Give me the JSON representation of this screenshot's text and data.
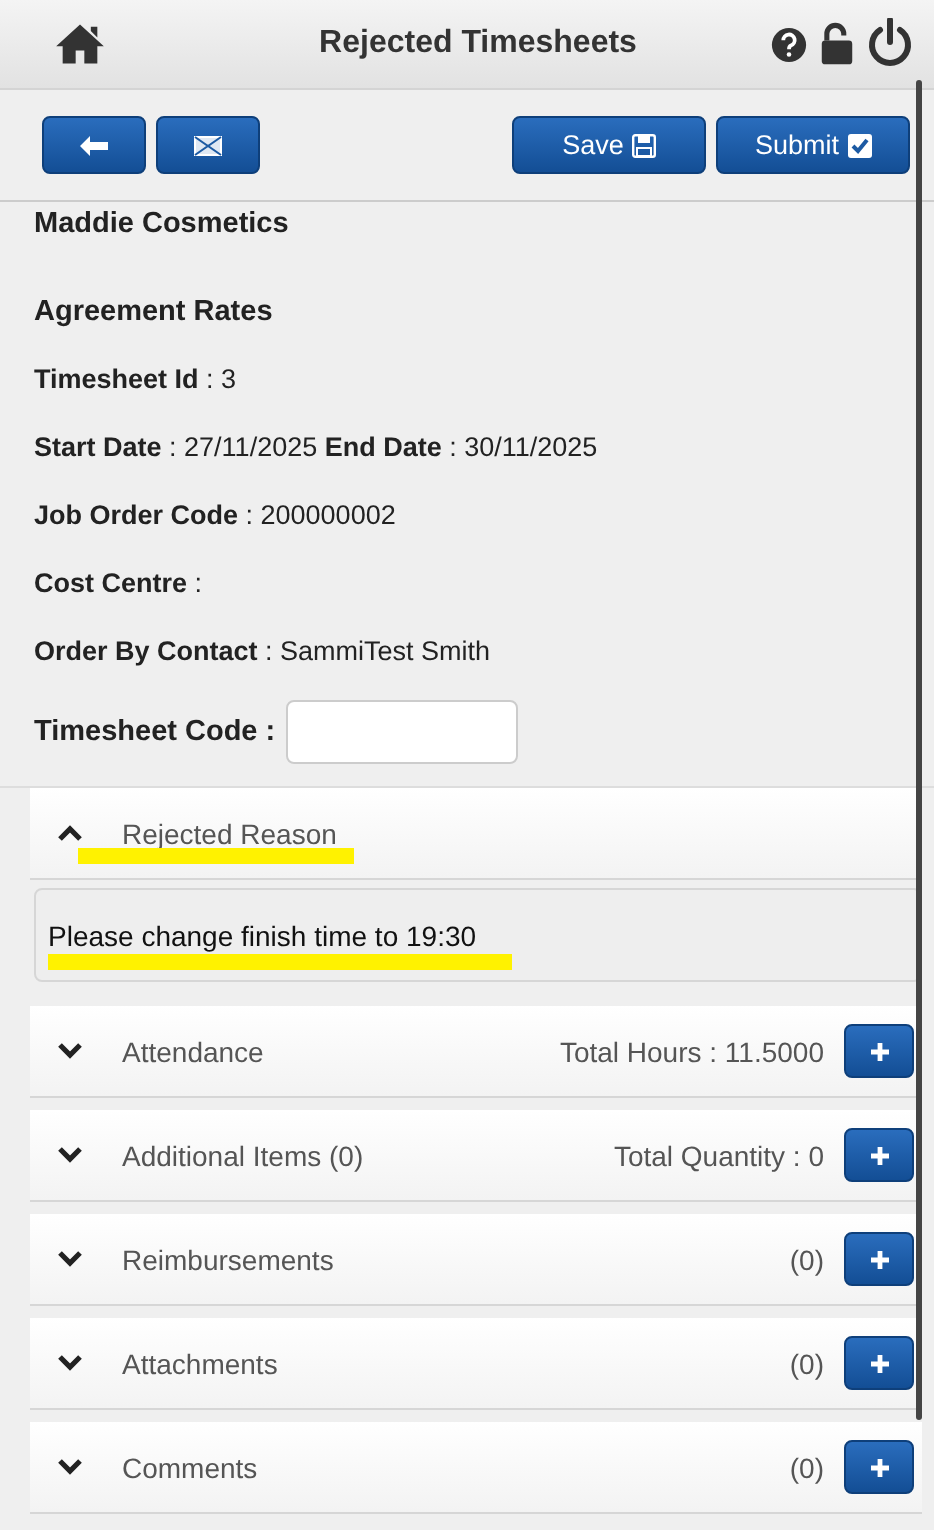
{
  "header": {
    "title": "Rejected Timesheets"
  },
  "toolbar": {
    "buttons": [
      {
        "kind": "back"
      },
      {
        "kind": "email"
      },
      {
        "kind": "save",
        "label": "Save"
      },
      {
        "kind": "submit",
        "label": "Submit"
      }
    ]
  },
  "company": "Maddie Cosmetics",
  "subheading": "Agreement Rates",
  "fields": [
    {
      "text": "**Timesheet Id** : 3"
    },
    {
      "text": "**Start Date** : 27/11/2025 **End Date** : 30/11/2025"
    },
    {
      "text": "**Job Order Code** : 200000002"
    },
    {
      "text": "**Cost Centre** :"
    },
    {
      "text": "**Order By Contact** : SammiTest Smith"
    }
  ],
  "timesheet_code": {
    "label": "Timesheet Code :"
  },
  "sections": [
    {
      "title": "Rejected Reason",
      "expanded": true,
      "highlighted": true,
      "content": "Please change finish time to 19:30",
      "content_highlighted": true,
      "add_button": false
    },
    {
      "title": "Attendance",
      "expanded": false,
      "highlighted": false,
      "summary": "Total Hours : 11.5000",
      "add_button": true
    },
    {
      "title": "Additional Items (0)",
      "expanded": false,
      "highlighted": false,
      "summary": "Total Quantity : 0",
      "add_button": true
    },
    {
      "title": "Reimbursements",
      "expanded": false,
      "highlighted": false,
      "summary": "(0)",
      "add_button": true
    },
    {
      "title": "Attachments",
      "expanded": false,
      "highlighted": false,
      "summary": "(0)",
      "add_button": true
    },
    {
      "title": "Comments",
      "expanded": false,
      "highlighted": false,
      "summary": "(0)",
      "add_button": true
    }
  ]
}
